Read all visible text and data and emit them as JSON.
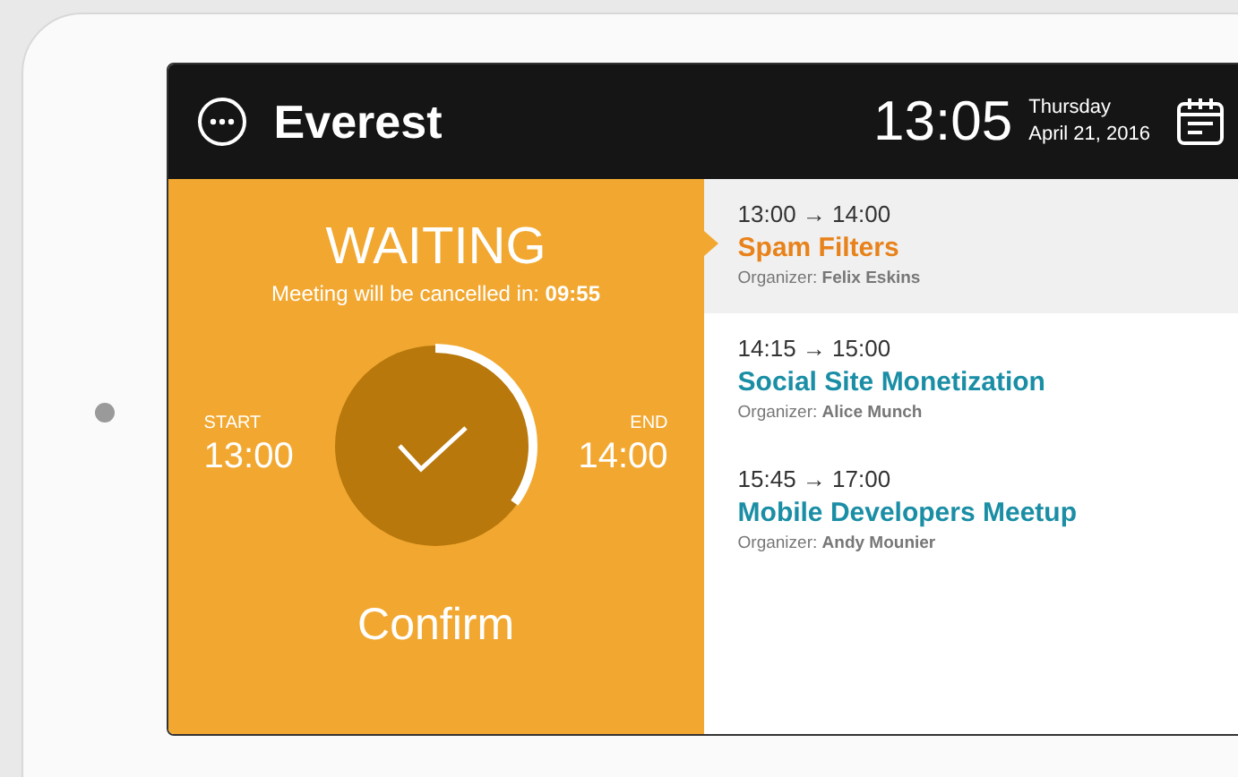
{
  "header": {
    "room": "Everest",
    "time": "13:05",
    "day": "Thursday",
    "date": "April 21, 2016"
  },
  "status": {
    "title": "WAITING",
    "countdown": "Meeting will be cancelled in: **09:55**",
    "start_label": "START",
    "start_time": "13:00",
    "end_label": "END",
    "end_time": "14:00",
    "level": 0.34,
    "confirm": "Confirm"
  },
  "meetings": [
    {
      "time": "13:00 → 14:00",
      "title": "Spam Filters",
      "organizer": "Organizer: **Felix Eskins**",
      "selected": true
    },
    {
      "time": "14:15 → 15:00",
      "title": "Social Site Monetization",
      "organizer": "Organizer: **Alice Munch**",
      "selected": false
    },
    {
      "time": "15:45 → 17:00",
      "title": "Mobile Developers Meetup",
      "organizer": "Organizer: **Andy Mounier**",
      "selected": false
    }
  ]
}
